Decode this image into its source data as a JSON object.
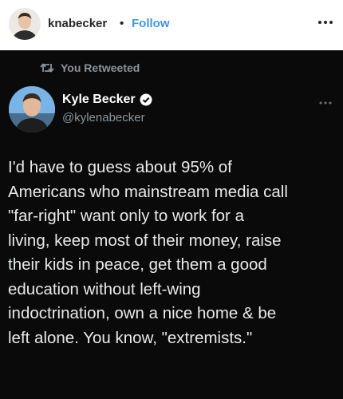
{
  "instagram_header": {
    "username": "knabecker",
    "separator": "•",
    "follow_label": "Follow",
    "more_icon": "more-horizontal-icon",
    "follow_color": "#3897f0"
  },
  "tweet": {
    "retweet_label": "You Retweeted",
    "retweet_icon": "retweet-icon",
    "display_name": "Kyle Becker",
    "verified_icon": "verified-badge-icon",
    "handle": "@kylenabecker",
    "more_icon": "more-horizontal-icon",
    "text": "I'd have to guess about 95% of\nAmericans who mainstream media call\n\"far-right\" want only to work for a\nliving, keep most of their money, raise\ntheir kids in peace, get them a good\neducation without left-wing\nindoctrination, own a nice home & be\nleft alone. You know, \"extremists.\"",
    "background_color": "#0a0a0a"
  }
}
